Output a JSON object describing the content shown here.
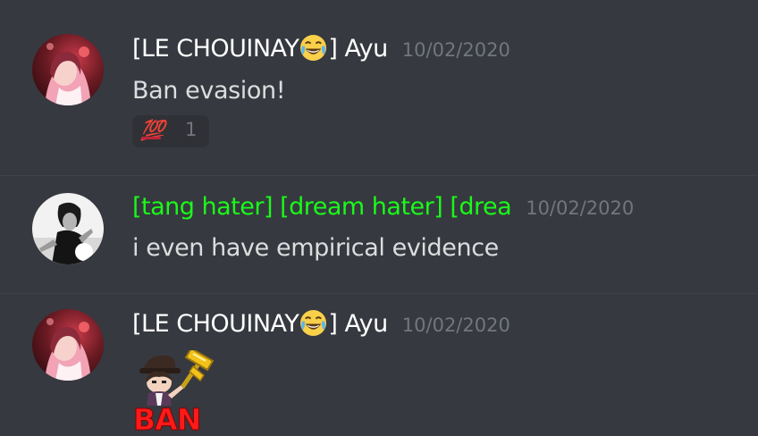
{
  "messages": [
    {
      "username_prefix": "[LE CHOUINAY",
      "username_suffix": "] Ayu",
      "emoji_icon": "joy-emoji-icon",
      "timestamp": "10/02/2020",
      "text": "Ban evasion!",
      "reaction": {
        "emoji": "💯",
        "count": "1"
      }
    },
    {
      "username": "[tang hater] [dream hater] [drea",
      "username_color": "#1bf91b",
      "timestamp": "10/02/2020",
      "text": "i even have empirical evidence"
    },
    {
      "username_prefix": "[LE CHOUINAY",
      "username_suffix": "] Ayu",
      "emoji_icon": "joy-emoji-icon",
      "timestamp": "10/02/2020",
      "sticker": {
        "icon": "ban-hammer-sticker",
        "text": "BAN"
      }
    }
  ],
  "colors": {
    "background": "#36393f",
    "username": "#ffffff",
    "timestamp": "#72767d",
    "message_text": "#dcddde",
    "reaction_bg": "#2f3136",
    "sticker_text": "#ff1a1a"
  }
}
